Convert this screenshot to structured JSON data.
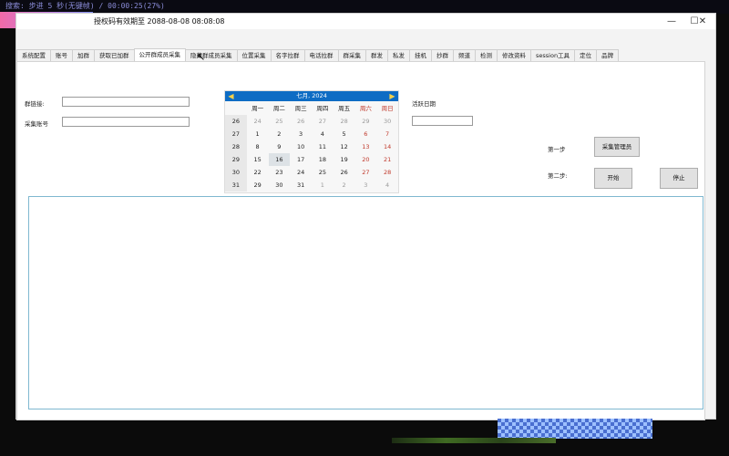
{
  "top_status": "搜索: 步进 5 秒(无键帧) / 00:00:25(27%)",
  "window": {
    "title": "授权码有效期至 2088-08-08 08:08:08",
    "minimize": "—",
    "maximize": "☐",
    "close": "✕"
  },
  "tabs": [
    {
      "label": "系统配置"
    },
    {
      "label": "账号"
    },
    {
      "label": "加群"
    },
    {
      "label": "获取已加群"
    },
    {
      "label": "公开群成员采集",
      "active": true
    },
    {
      "label": "隐藏群成员采集"
    },
    {
      "label": "位置采集"
    },
    {
      "label": "名字拉群"
    },
    {
      "label": "电话拉群"
    },
    {
      "label": "群采集"
    },
    {
      "label": "群发"
    },
    {
      "label": "私发"
    },
    {
      "label": "挂机"
    },
    {
      "label": "抄群"
    },
    {
      "label": "频道"
    },
    {
      "label": "检测"
    },
    {
      "label": "修改资料"
    },
    {
      "label": "session工具"
    },
    {
      "label": "定位"
    },
    {
      "label": "品牌"
    }
  ],
  "form": {
    "group_link_label": "群链接:",
    "group_link_value": "",
    "collect_account_label": "采集账号",
    "collect_account_value": "",
    "active_date_label": "活跃日期",
    "active_date_value": "",
    "step1_label": "第一步",
    "step1_button": "采集管理员",
    "step2_label": "第二步:",
    "start_button": "开始",
    "stop_button": "停止"
  },
  "calendar": {
    "header": "七月, 2024",
    "prev_icon": "left-arrow",
    "next_icon": "right-arrow",
    "weekdays": [
      "周一",
      "周二",
      "周三",
      "周四",
      "周五",
      "周六",
      "周日"
    ],
    "weeks": [
      {
        "wk": "26",
        "days": [
          "24",
          "25",
          "26",
          "27",
          "28",
          "29",
          "30"
        ]
      },
      {
        "wk": "27",
        "days": [
          "1",
          "2",
          "3",
          "4",
          "5",
          "6",
          "7"
        ]
      },
      {
        "wk": "28",
        "days": [
          "8",
          "9",
          "10",
          "11",
          "12",
          "13",
          "14"
        ]
      },
      {
        "wk": "29",
        "days": [
          "15",
          "16",
          "17",
          "18",
          "19",
          "20",
          "21"
        ]
      },
      {
        "wk": "30",
        "days": [
          "22",
          "23",
          "24",
          "25",
          "26",
          "27",
          "28"
        ]
      },
      {
        "wk": "31",
        "days": [
          "29",
          "30",
          "31",
          "1",
          "2",
          "3",
          "4"
        ]
      }
    ],
    "today": "16",
    "weekend_color": "#c0392b"
  },
  "log": {
    "content": ""
  },
  "colors": {
    "calendar_header": "#0e6cc4",
    "log_border": "#7fb8d0"
  }
}
